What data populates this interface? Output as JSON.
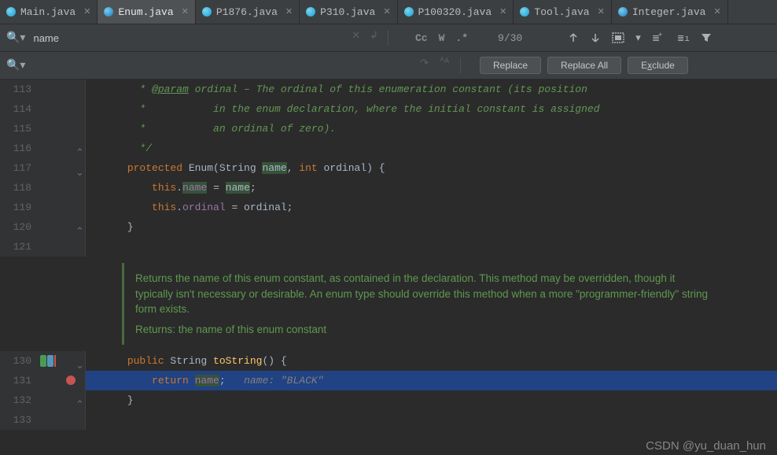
{
  "tabs": [
    {
      "label": "Main.java"
    },
    {
      "label": "Enum.java"
    },
    {
      "label": "P1876.java"
    },
    {
      "label": "P310.java"
    },
    {
      "label": "P100320.java"
    },
    {
      "label": "Tool.java"
    },
    {
      "label": "Integer.java"
    }
  ],
  "find": {
    "value": "name",
    "count": "9/30"
  },
  "options": {
    "cc": "Cc",
    "w": "W",
    "regex": ".*"
  },
  "buttons": {
    "replace_p": "R",
    "replace_s": "eplace",
    "replaceall": "Replace All",
    "exclude_p": "E",
    "exclude_s": "x",
    "exclude_t": "clude"
  },
  "lines": {
    "l113": "113",
    "l114": "114",
    "l115": "115",
    "l116": "116",
    "l117": "117",
    "l118": "118",
    "l119": "119",
    "l120": "120",
    "l121": "121",
    "l130": "130",
    "l131": "131",
    "l132": "132",
    "l133": "133"
  },
  "code": {
    "c113_pre": "        * ",
    "c113_tag": "@param",
    "c113_rest": " ordinal – The ordinal of this enumeration constant (its position",
    "c114": "        *           in the enum declaration, where the initial constant is assigned",
    "c115": "        *           an ordinal of zero).",
    "c116": "        */",
    "c117_kw": "protected ",
    "c117_cls": "Enum",
    "c117_p1": "(String ",
    "c117_name": "name",
    "c117_p2": ", ",
    "c117_int": "int",
    "c117_p3": " ordinal) {",
    "c118_pre": "          ",
    "c118_this": "this",
    "c118_dot": ".",
    "c118_fld": "name",
    "c118_eq": " = ",
    "c118_rhs": "name",
    "c118_sc": ";",
    "c119_pre": "          ",
    "c119_this": "this",
    "c119_dot": ".",
    "c119_fld": "ordinal",
    "c119_eq": " = ordinal;",
    "c120": "      }",
    "c130_kw": "public ",
    "c130_typ": "String ",
    "c130_mtd": "toString",
    "c130_p": "() {",
    "c131_pre": "          ",
    "c131_ret": "return ",
    "c131_name": "name",
    "c131_sc": ";   ",
    "c131_hint": "name: \"BLACK\"",
    "c132": "      }"
  },
  "doc": {
    "p1": "Returns the name of this enum constant, as contained in the declaration. This method may be overridden, though it typically isn't necessary or desirable. An enum type should override this method when a more \"programmer-friendly\" string form exists.",
    "p2": "Returns: the name of this enum constant"
  },
  "watermark": "CSDN @yu_duan_hun"
}
